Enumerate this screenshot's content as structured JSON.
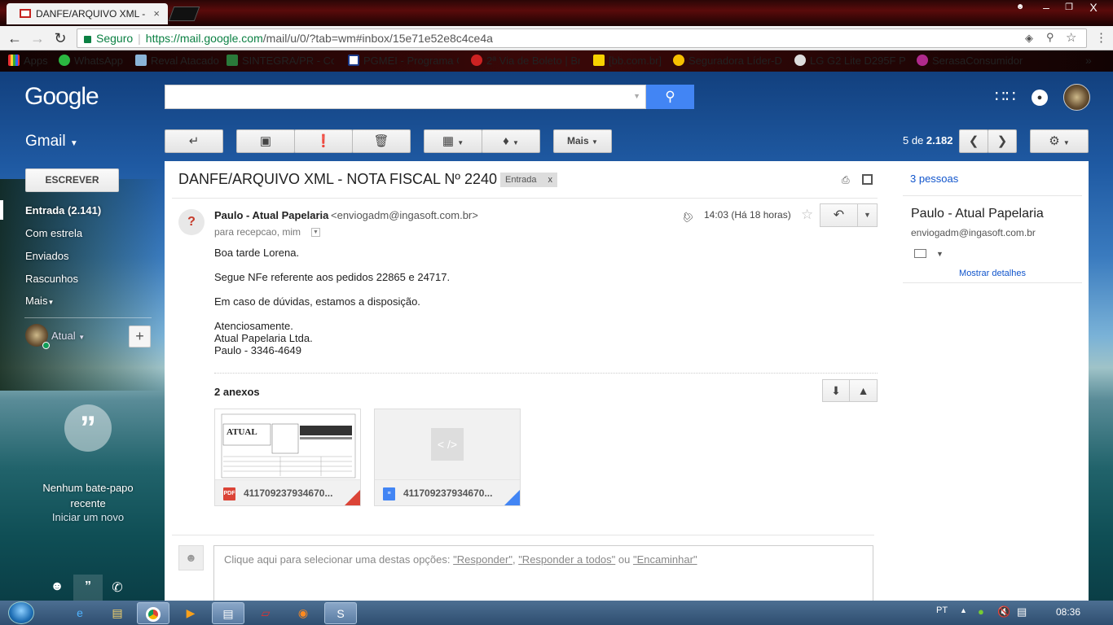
{
  "browser": {
    "tab_title": "DANFE/ARQUIVO XML -",
    "tab_close": "×",
    "secure_label": "Seguro",
    "url_host": "https://mail.google.com",
    "url_path": "/mail/u/0/?tab=wm#inbox/15e71e52e8c4ce4a",
    "bookmarks": [
      "Apps",
      "WhatsApp",
      "Reval Atacado",
      "SINTEGRA/PR - Cons",
      "PGMEI - Programa Ge",
      "2ª Via de Boleto | Bra",
      "[bb.com.br]",
      "Seguradora Líder-DP",
      "LG G2 Lite D295F Par",
      "SerasaConsumidor"
    ],
    "bookmark_more": "»",
    "window_minimize": "–",
    "window_restore": "❐",
    "window_close": "X"
  },
  "header": {
    "logo": "Google",
    "search_button_icon": "search-icon",
    "app_title": "Gmail"
  },
  "toolbar": {
    "more_label": "Mais",
    "count_prefix": "5 de ",
    "count_total": "2.182"
  },
  "sidebar": {
    "compose_label": "ESCREVER",
    "items": [
      {
        "label": "Entrada (2.141)"
      },
      {
        "label": "Com estrela"
      },
      {
        "label": "Enviados"
      },
      {
        "label": "Rascunhos"
      },
      {
        "label": "Mais"
      }
    ],
    "hangouts_user": "Atual",
    "no_chats": "Nenhum bate-papo recente",
    "start_new": "Iniciar um novo"
  },
  "message": {
    "subject": "DANFE/ARQUIVO XML - NOTA FISCAL Nº 2240",
    "label": "Entrada",
    "label_remove": "x",
    "sender_name": "Paulo - Atual Papelaria",
    "sender_email": "<enviogadm@ingasoft.com.br>",
    "recipients": "para recepcao, mim",
    "time": "14:03 (Há 18 horas)",
    "body": [
      "Boa tarde Lorena.",
      "Segue NFe referente aos pedidos 22865 e 24717.",
      "Em caso de dúvidas, estamos a disposição.",
      "Atenciosamente.",
      "Atual Papelaria Ltda.",
      "Paulo - 3346-4649"
    ],
    "attachments_title": "2 anexos",
    "attachments": [
      {
        "name": "411709237934670...",
        "type": "PDF"
      },
      {
        "name": "411709237934670...",
        "type": "XML"
      }
    ],
    "reply_prompt": "Clique aqui para selecionar uma destas opções: ",
    "reply_opt_reply": "\"Responder\"",
    "reply_opt_reply_all": "\"Responder a todos\"",
    "reply_or": " ou ",
    "reply_opt_forward": "\"Encaminhar\"",
    "reply_comma": ", "
  },
  "contact_panel": {
    "people_count": "3 pessoas",
    "name": "Paulo - Atual Papelaria",
    "email": "enviogadm@ingasoft.com.br",
    "show_details": "Mostrar detalhes"
  },
  "taskbar": {
    "language": "PT",
    "clock": "08:36"
  },
  "colors": {
    "accent": "#4285f4",
    "pdf": "#db4437",
    "doc": "#4285f4",
    "link": "#1155cc"
  }
}
